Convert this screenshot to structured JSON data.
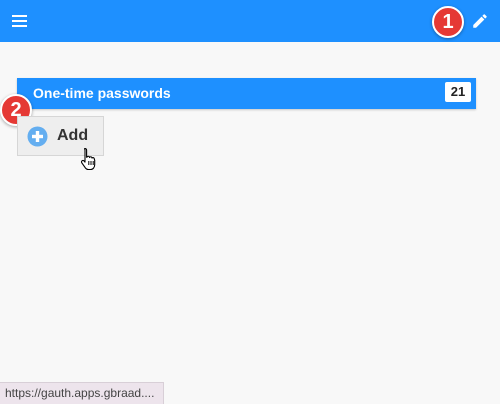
{
  "colors": {
    "primary": "#1e90ff",
    "background": "#f8f8f8",
    "step_badge": "#e53935",
    "add_icon": "#64aef0"
  },
  "header": {
    "menu_icon": "hamburger-menu-icon",
    "edit_icon": "pencil-icon"
  },
  "annotations": {
    "step1": "1",
    "step2": "2"
  },
  "category": {
    "label": "One-time passwords",
    "count": "21"
  },
  "add_button": {
    "label": "Add",
    "icon": "plus-circle-icon"
  },
  "status_bar": {
    "url": "https://gauth.apps.gbraad...."
  }
}
